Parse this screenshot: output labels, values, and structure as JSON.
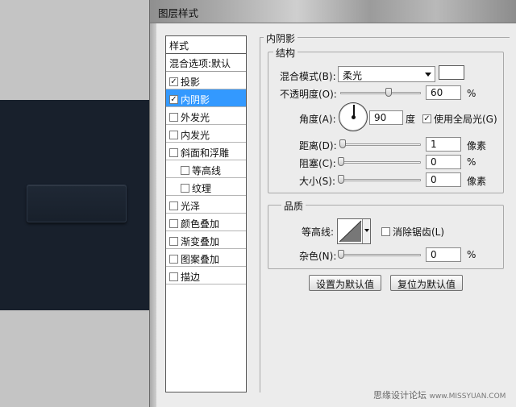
{
  "window": {
    "title": "图层样式"
  },
  "style_list": {
    "header": "样式",
    "blend_options": "混合选项:默认",
    "items": [
      {
        "label": "投影",
        "checked": true,
        "selected": false,
        "sub": false
      },
      {
        "label": "内阴影",
        "checked": true,
        "selected": true,
        "sub": false
      },
      {
        "label": "外发光",
        "checked": false,
        "selected": false,
        "sub": false
      },
      {
        "label": "内发光",
        "checked": false,
        "selected": false,
        "sub": false
      },
      {
        "label": "斜面和浮雕",
        "checked": false,
        "selected": false,
        "sub": false
      },
      {
        "label": "等高线",
        "checked": false,
        "selected": false,
        "sub": true
      },
      {
        "label": "纹理",
        "checked": false,
        "selected": false,
        "sub": true
      },
      {
        "label": "光泽",
        "checked": false,
        "selected": false,
        "sub": false
      },
      {
        "label": "颜色叠加",
        "checked": false,
        "selected": false,
        "sub": false
      },
      {
        "label": "渐变叠加",
        "checked": false,
        "selected": false,
        "sub": false
      },
      {
        "label": "图案叠加",
        "checked": false,
        "selected": false,
        "sub": false
      },
      {
        "label": "描边",
        "checked": false,
        "selected": false,
        "sub": false
      }
    ]
  },
  "panel": {
    "title": "内阴影",
    "structure": {
      "title": "结构",
      "blend_mode_label": "混合模式(B):",
      "blend_mode_value": "柔光",
      "blend_color": "#ffffff",
      "opacity_label": "不透明度(O):",
      "opacity_value": "60",
      "opacity_unit": "%",
      "opacity_fraction": 0.6,
      "angle_label": "角度(A):",
      "angle_value": "90",
      "angle_unit": "度",
      "global_light_label": "使用全局光(G)",
      "global_light_checked": true,
      "distance_label": "距离(D):",
      "distance_value": "1",
      "distance_unit": "像素",
      "choke_label": "阻塞(C):",
      "choke_value": "0",
      "choke_unit": "%",
      "size_label": "大小(S):",
      "size_value": "0",
      "size_unit": "像素"
    },
    "quality": {
      "title": "品质",
      "contour_label": "等高线:",
      "antialias_label": "消除锯齿(L)",
      "antialias_checked": false,
      "noise_label": "杂色(N):",
      "noise_value": "0",
      "noise_unit": "%"
    },
    "buttons": {
      "set_default": "设置为默认值",
      "reset_default": "复位为默认值"
    }
  },
  "watermark": {
    "text": "思缘设计论坛",
    "url": "www.MISSYUAN.COM"
  }
}
